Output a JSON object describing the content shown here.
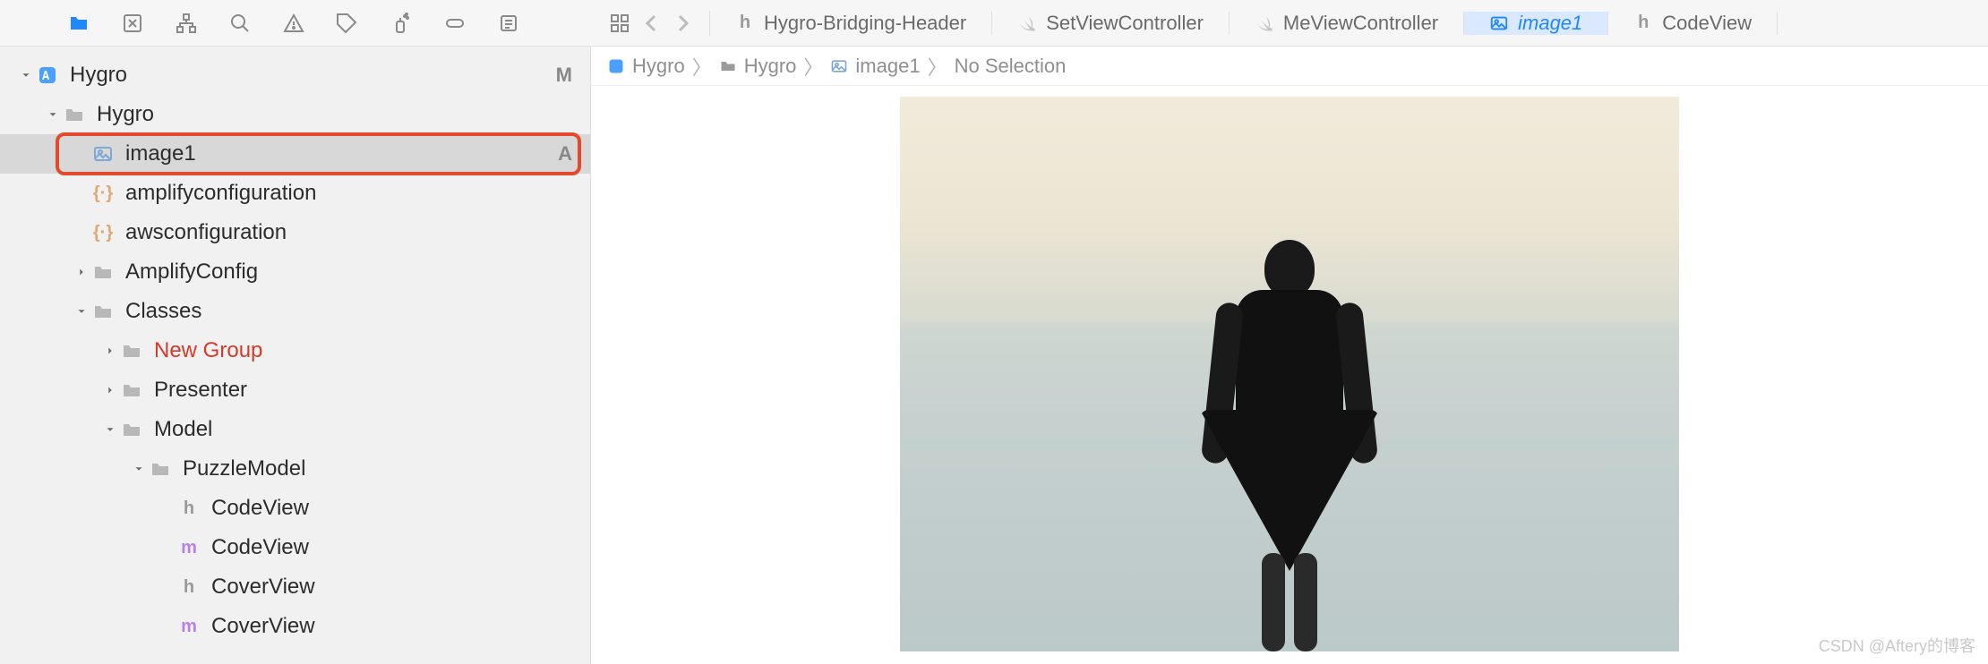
{
  "toolbar_icons": [
    "folder",
    "inspector",
    "hierarchy",
    "search",
    "warning",
    "tag",
    "spray",
    "capsule",
    "list"
  ],
  "tabs": [
    {
      "icon": "h",
      "label": "Hygro-Bridging-Header",
      "active": false
    },
    {
      "icon": "swift",
      "label": "SetViewController",
      "active": false
    },
    {
      "icon": "swift",
      "label": "MeViewController",
      "active": false
    },
    {
      "icon": "image",
      "label": "image1",
      "active": true
    },
    {
      "icon": "h",
      "label": "CodeView",
      "active": false
    }
  ],
  "breadcrumb": [
    {
      "icon": "proj",
      "label": "Hygro"
    },
    {
      "icon": "folder",
      "label": "Hygro"
    },
    {
      "icon": "image",
      "label": "image1"
    },
    {
      "icon": "",
      "label": "No Selection"
    }
  ],
  "tree": [
    {
      "depth": 0,
      "icon": "proj",
      "label": "Hygro",
      "disclosure": "down",
      "status": "M",
      "selected": false
    },
    {
      "depth": 1,
      "icon": "folder",
      "label": "Hygro",
      "disclosure": "down"
    },
    {
      "depth": 2,
      "icon": "image",
      "label": "image1",
      "status": "A",
      "selected": true,
      "highlight": true
    },
    {
      "depth": 2,
      "icon": "json",
      "label": "amplifyconfiguration"
    },
    {
      "depth": 2,
      "icon": "json",
      "label": "awsconfiguration"
    },
    {
      "depth": 2,
      "icon": "folder",
      "label": "AmplifyConfig",
      "disclosure": "right"
    },
    {
      "depth": 2,
      "icon": "folder",
      "label": "Classes",
      "disclosure": "down"
    },
    {
      "depth": 3,
      "icon": "folder",
      "label": "New Group",
      "disclosure": "right",
      "red": true
    },
    {
      "depth": 3,
      "icon": "folder",
      "label": "Presenter",
      "disclosure": "right"
    },
    {
      "depth": 3,
      "icon": "folder",
      "label": "Model",
      "disclosure": "down"
    },
    {
      "depth": 4,
      "icon": "folder",
      "label": "PuzzleModel",
      "disclosure": "down"
    },
    {
      "depth": 5,
      "icon": "h",
      "label": "CodeView"
    },
    {
      "depth": 5,
      "icon": "m",
      "label": "CodeView"
    },
    {
      "depth": 5,
      "icon": "h",
      "label": "CoverView"
    },
    {
      "depth": 5,
      "icon": "m",
      "label": "CoverView"
    }
  ],
  "watermark": "CSDN @Aftery的博客"
}
